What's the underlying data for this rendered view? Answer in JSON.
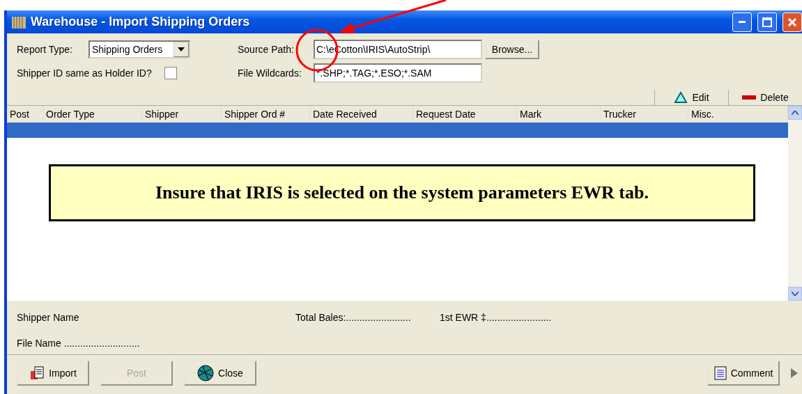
{
  "window": {
    "title": "Warehouse - Import Shipping Orders"
  },
  "form": {
    "report_type": {
      "label": "Report Type:",
      "value": "Shipping Orders"
    },
    "shipper_same": {
      "label": "Shipper ID same as Holder ID?",
      "checked": false
    },
    "source_path": {
      "label": "Source Path:",
      "value": "C:\\eCotton\\IRIS\\AutoStrip\\"
    },
    "browse": "Browse...",
    "wildcards": {
      "label": "File Wildcards:",
      "value": "*.SHP;*.TAG;*.ESO;*.SAM"
    }
  },
  "toolbar": [
    {
      "label": "Edit",
      "kind": "edit"
    },
    {
      "label": "Delete",
      "kind": "delete"
    }
  ],
  "table": {
    "columns": [
      "Post",
      "Order Type",
      "Shipper",
      "Shipper Ord #",
      "Date Received",
      "Request Date",
      "Mark",
      "Trucker",
      "Misc."
    ],
    "rows": [
      {
        "selected": true
      }
    ]
  },
  "callout": "Insure that IRIS is selected on the system parameters EWR tab.",
  "summary": {
    "shipper_name": "Shipper Name",
    "total_bales": "Total Bales:........................",
    "first_ewr": "1st EWR ‡........................",
    "file_name": "File Name ............................"
  },
  "buttons": [
    {
      "label": "Import",
      "kind": "import",
      "disabled": false
    },
    {
      "label": "Post",
      "kind": "post",
      "disabled": true
    },
    {
      "label": "Close",
      "kind": "close",
      "disabled": false
    },
    {
      "label": "Comment",
      "kind": "comment",
      "disabled": false
    }
  ]
}
